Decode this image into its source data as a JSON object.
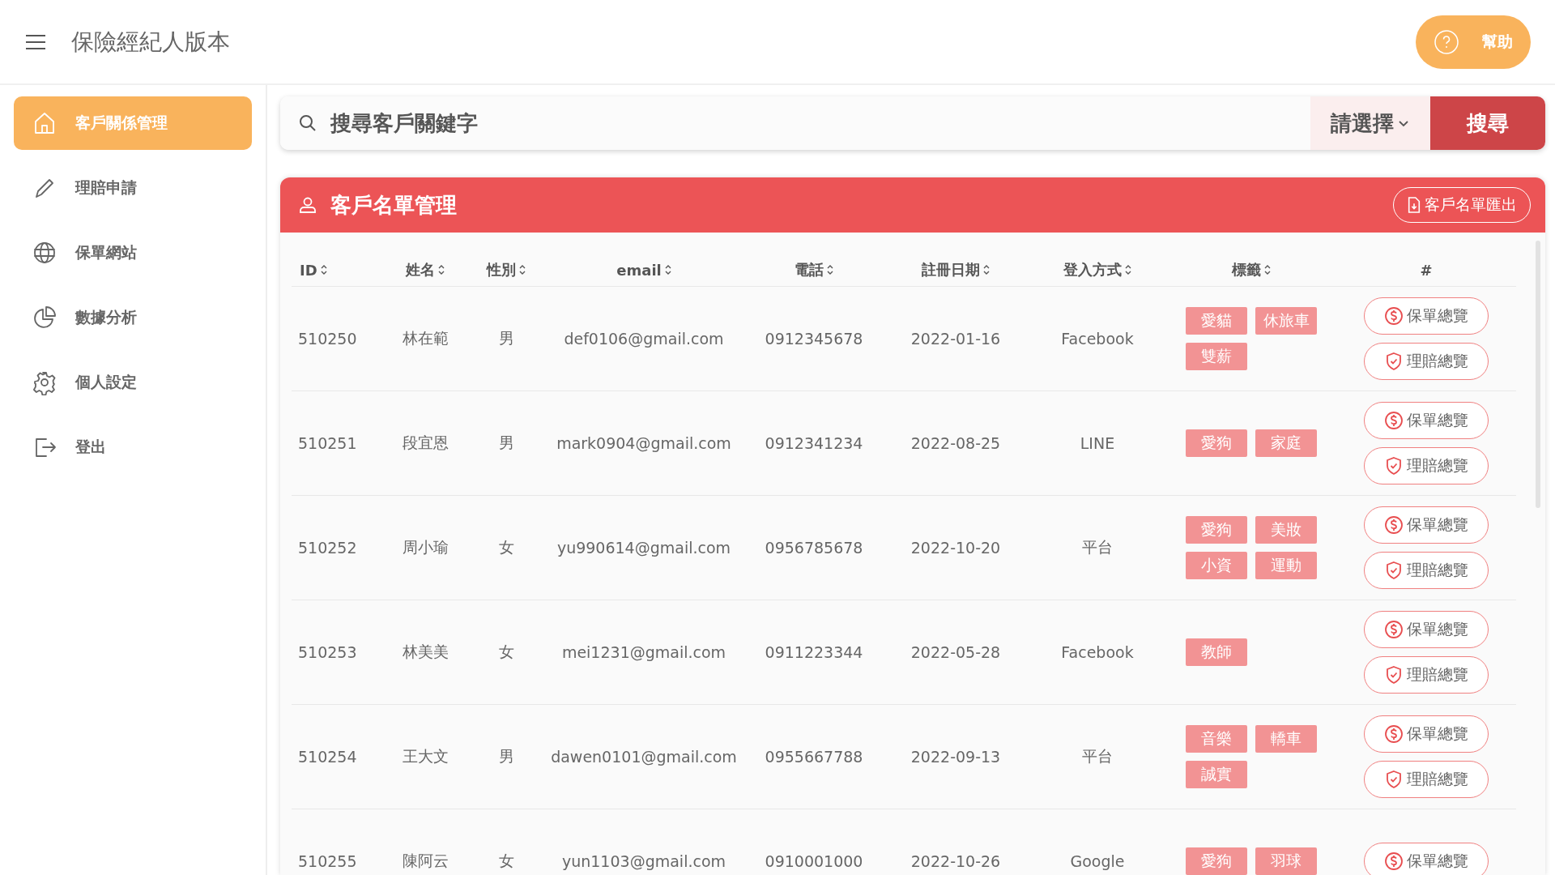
{
  "header": {
    "title": "保險經紀人版本",
    "help_button": "幫助"
  },
  "sidebar": {
    "items": [
      {
        "label": "客戶關係管理",
        "selected": true
      },
      {
        "label": "理賠申請",
        "selected": false
      },
      {
        "label": "保單網站",
        "selected": false
      },
      {
        "label": "數據分析",
        "selected": false
      },
      {
        "label": "個人設定",
        "selected": false
      },
      {
        "label": "登出",
        "selected": false
      }
    ]
  },
  "search": {
    "placeholder": "搜尋客戶關鍵字",
    "select": "請選擇",
    "button": "搜尋"
  },
  "card": {
    "title": "客戶名單管理",
    "export_button": "客戶名單匯出"
  },
  "table": {
    "columns": [
      {
        "label": "ID",
        "sortable": true
      },
      {
        "label": "姓名",
        "sortable": true
      },
      {
        "label": "性別",
        "sortable": true
      },
      {
        "label": "email",
        "sortable": true
      },
      {
        "label": "電話",
        "sortable": true
      },
      {
        "label": "註冊日期",
        "sortable": true
      },
      {
        "label": "登入方式",
        "sortable": true
      },
      {
        "label": "標籤",
        "sortable": true
      },
      {
        "label": "#",
        "sortable": false
      }
    ],
    "rows": [
      {
        "id": "510250",
        "name": "林在範",
        "gender": "男",
        "email": "def0106@gmail.com",
        "phone": "0912345678",
        "date": "2022-01-16",
        "login": "Facebook",
        "tags": [
          "愛貓",
          "休旅車",
          "雙薪"
        ],
        "actions": [
          {
            "kind": "policy",
            "label": "保單總覽"
          },
          {
            "kind": "claim",
            "label": "理賠總覽"
          }
        ]
      },
      {
        "id": "510251",
        "name": "段宜恩",
        "gender": "男",
        "email": "mark0904@gmail.com",
        "phone": "0912341234",
        "date": "2022-08-25",
        "login": "LINE",
        "tags": [
          "愛狗",
          "家庭"
        ],
        "actions": [
          {
            "kind": "policy",
            "label": "保單總覽"
          },
          {
            "kind": "claim",
            "label": "理賠總覽"
          }
        ]
      },
      {
        "id": "510252",
        "name": "周小瑜",
        "gender": "女",
        "email": "yu990614@gmail.com",
        "phone": "0956785678",
        "date": "2022-10-20",
        "login": "平台",
        "tags": [
          "愛狗",
          "美妝",
          "小資",
          "運動"
        ],
        "actions": [
          {
            "kind": "policy",
            "label": "保單總覽"
          },
          {
            "kind": "claim",
            "label": "理賠總覽"
          }
        ]
      },
      {
        "id": "510253",
        "name": "林美美",
        "gender": "女",
        "email": "mei1231@gmail.com",
        "phone": "0911223344",
        "date": "2022-05-28",
        "login": "Facebook",
        "tags": [
          "教師"
        ],
        "actions": [
          {
            "kind": "policy",
            "label": "保單總覽"
          },
          {
            "kind": "claim",
            "label": "理賠總覽"
          }
        ]
      },
      {
        "id": "510254",
        "name": "王大文",
        "gender": "男",
        "email": "dawen0101@gmail.com",
        "phone": "0955667788",
        "date": "2022-09-13",
        "login": "平台",
        "tags": [
          "音樂",
          "轎車",
          "誠實"
        ],
        "actions": [
          {
            "kind": "policy",
            "label": "保單總覽"
          },
          {
            "kind": "claim",
            "label": "理賠總覽"
          }
        ]
      },
      {
        "id": "510255",
        "name": "陳阿云",
        "gender": "女",
        "email": "yun1103@gmail.com",
        "phone": "0910001000",
        "date": "2022-10-26",
        "login": "Google",
        "tags": [
          "愛狗",
          "羽球"
        ],
        "actions": [
          {
            "kind": "policy",
            "label": "保單總覽"
          }
        ]
      }
    ]
  }
}
